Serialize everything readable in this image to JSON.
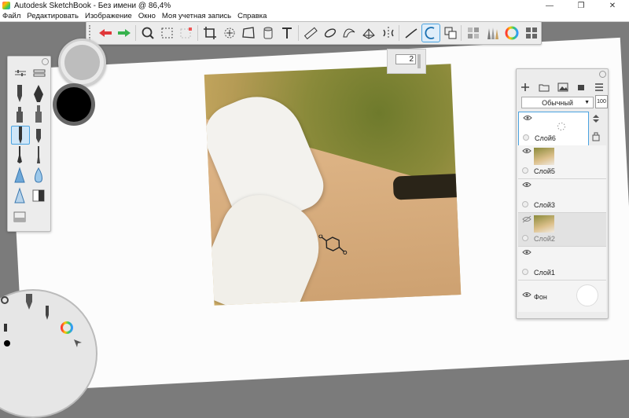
{
  "window": {
    "title": "Autodesk SketchBook - Без имени @ 86,4%",
    "controls": {
      "minimize": "—",
      "maximize": "❐",
      "close": "✕"
    }
  },
  "menu": [
    "Файл",
    "Редактировать",
    "Изображение",
    "Окно",
    "Моя учетная запись",
    "Справка"
  ],
  "toolbar": {
    "tools": [
      "undo-icon",
      "redo-icon",
      "zoom-icon",
      "select-icon",
      "select-alt-icon",
      "crop-icon",
      "transform-icon",
      "distort-icon",
      "fill-icon",
      "text-icon",
      "ruler-icon",
      "ellipse-guide-icon",
      "french-curve-icon",
      "perspective-icon",
      "symmetry-icon",
      "stroke-icon",
      "predictive-stroke-icon",
      "copy-paste-icon",
      "brush-library-icon",
      "brushes-icon",
      "color-wheel-icon",
      "layers-icon"
    ],
    "active_tool": "predictive-stroke-icon"
  },
  "canvas": {
    "brush_size_value": "2"
  },
  "layers_panel": {
    "blend_mode": "Обычный",
    "opacity": "100",
    "layers": [
      {
        "name": "Слой6",
        "selected": true,
        "thumb": false,
        "visible": true
      },
      {
        "name": "Слой5",
        "selected": false,
        "thumb": true,
        "visible": true
      },
      {
        "name": "Слой3",
        "selected": false,
        "thumb": false,
        "visible": true
      },
      {
        "name": "Слой2",
        "selected": false,
        "thumb": true,
        "visible": false
      },
      {
        "name": "Слой1",
        "selected": false,
        "thumb": false,
        "visible": true
      },
      {
        "name": "Фон",
        "selected": false,
        "thumb": false,
        "visible": true
      }
    ]
  },
  "colors": {
    "accent": "#4aa3e0",
    "primary_color": "#bdbdbd",
    "secondary_color": "#000000"
  }
}
